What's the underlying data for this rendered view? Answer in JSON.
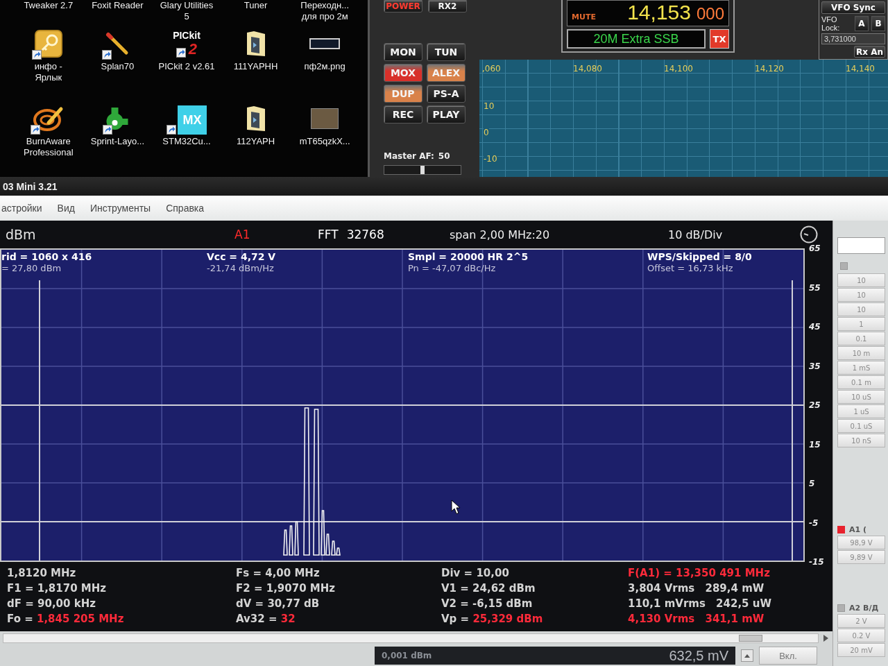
{
  "desktop": {
    "rows": [
      [
        {
          "lines": [
            "Tweaker 2.7"
          ]
        },
        {
          "lines": [
            "Foxit Reader"
          ]
        },
        {
          "lines": [
            "Glary Utilities",
            "5"
          ]
        },
        {
          "lines": [
            "Tuner"
          ]
        },
        {
          "lines": [
            "Переходн...",
            "для про 2м"
          ]
        }
      ],
      [
        {
          "lines": [
            "инфо -",
            "Ярлык"
          ],
          "kind": "key",
          "shortcut": true
        },
        {
          "lines": [
            "Splan70"
          ],
          "kind": "pencil",
          "shortcut": true
        },
        {
          "lines": [
            "PICkit 2 v2.61"
          ],
          "kind": "pickit",
          "logo": [
            "PICkit",
            "2"
          ],
          "shortcut": true
        },
        {
          "lines": [
            "111YAPHH"
          ],
          "kind": "folder",
          "shortcut": false
        },
        {
          "lines": [
            "пф2м.png"
          ],
          "kind": "image",
          "shortcut": false
        }
      ],
      [
        {
          "lines": [
            "BurnAware",
            "Professional"
          ],
          "kind": "burner",
          "shortcut": true
        },
        {
          "lines": [
            "Sprint-Layo..."
          ],
          "kind": "sprint",
          "shortcut": true
        },
        {
          "lines": [
            "STM32Cu..."
          ],
          "kind": "mx",
          "logo": [
            "MX"
          ],
          "shortcut": true
        },
        {
          "lines": [
            "112YAPH"
          ],
          "kind": "folder",
          "shortcut": false
        },
        {
          "lines": [
            "mT65qzkX..."
          ],
          "kind": "photo",
          "shortcut": false
        }
      ]
    ]
  },
  "radio": {
    "top_buttons": [
      {
        "label": "POWER",
        "on": true
      },
      {
        "label": "RX2",
        "on": false
      }
    ],
    "buttons": [
      {
        "label": "MON",
        "on": false
      },
      {
        "label": "TUN",
        "on": false
      },
      {
        "label": "MOX",
        "on": true,
        "color": "#d8302a"
      },
      {
        "label": "ALEX",
        "on": true,
        "color": "#d9824a"
      },
      {
        "label": "DUP",
        "on": true,
        "color": "#d9824a"
      },
      {
        "label": "PS-A",
        "on": false
      },
      {
        "label": "REC",
        "on": false
      },
      {
        "label": "PLAY",
        "on": false
      }
    ],
    "master_af": {
      "label": "Master AF:",
      "value": "50",
      "level": 0.5
    },
    "frequency": {
      "mute": "MUTE",
      "mhz": "14,153",
      "hz": "000"
    },
    "band": "20M Extra SSB",
    "tx_button": "TX",
    "vfo": {
      "sync_button": "VFO Sync",
      "lock_label": [
        "VFO",
        "Lock:"
      ],
      "lock_buttons": [
        "A",
        "B"
      ],
      "value": "3,731000",
      "rx_button": "Rx An"
    },
    "panadapter": {
      "x_labels": [
        ",060",
        "14,080",
        "14,100",
        "14,120",
        "14,140"
      ],
      "y_labels": [
        "10",
        "0",
        "-10"
      ]
    }
  },
  "scope": {
    "title": "03 Mini 3.21",
    "menu": [
      "астройки",
      "Вид",
      "Инструменты",
      "Справка"
    ],
    "header": {
      "unit": "dBm",
      "channel": "A1",
      "fft_label": "FFT",
      "fft_size": "32768",
      "span": "span 2,00 MHz:20",
      "scale": "10 dB/Div"
    },
    "readouts": [
      {
        "lines": [
          "rid = 1060 x 416",
          "= 27,80 dBm"
        ]
      },
      {
        "lines": [
          "Vcc = 4,72 V",
          "-21,74 dBm/Hz"
        ]
      },
      {
        "lines": [
          "Smpl = 20000 HR 2^5",
          "Pn = -47,07 dBc/Hz"
        ]
      },
      {
        "lines": [
          "WPS/Skipped = 8/0",
          "Offset = 16,73 kHz"
        ]
      }
    ],
    "y_axis_labels": [
      "65",
      "55",
      "45",
      "35",
      "25",
      "15",
      "5",
      "-5",
      "-15"
    ],
    "measurements": [
      [
        {
          "parts": [
            "1,8120 MHz"
          ],
          "value_red": false
        },
        {
          "label": "F1 =",
          "label_red": false,
          "parts": [
            "1,8170 MHz"
          ],
          "value_red": false
        },
        {
          "label": "dF =",
          "label_red": false,
          "parts": [
            "90,00 kHz"
          ],
          "value_red": false
        },
        {
          "label": "Fo =",
          "label_red": false,
          "parts": [
            "1,845 205 MHz"
          ],
          "value_red": true
        }
      ],
      [
        {
          "label": "Fs =",
          "label_red": false,
          "parts": [
            "4,00 MHz"
          ],
          "value_red": false
        },
        {
          "label": "F2 =",
          "label_red": false,
          "parts": [
            "1,9070 MHz"
          ],
          "value_red": false
        },
        {
          "label": "dV =",
          "label_red": false,
          "parts": [
            "30,77 dB"
          ],
          "value_red": false
        },
        {
          "label": "Av32 =",
          "label_red": false,
          "parts": [
            "32"
          ],
          "value_red": true
        }
      ],
      [
        {
          "label": "Div =",
          "label_red": false,
          "parts": [
            "10,00"
          ],
          "value_red": false
        },
        {
          "label": "V1 =",
          "label_red": false,
          "parts": [
            "24,62 dBm"
          ],
          "value_red": false
        },
        {
          "label": "V2 =",
          "label_red": false,
          "parts": [
            "-6,15 dBm"
          ],
          "value_red": false
        },
        {
          "label": "Vp =",
          "label_red": false,
          "parts": [
            "25,329 dBm"
          ],
          "value_red": true
        }
      ],
      [
        {
          "label": "F(A1) =",
          "label_red": true,
          "parts": [
            "13,350 491 MHz"
          ],
          "value_red": true
        },
        {
          "parts": [
            "3,804 Vrms",
            "289,4 mW"
          ],
          "value_red": false
        },
        {
          "parts": [
            "110,1 mVrms",
            "242,5 uW"
          ],
          "value_red": false
        },
        {
          "parts": [
            "4,130 Vrms",
            "341,1 mW"
          ],
          "value_red": true
        }
      ]
    ],
    "side_panel": {
      "checkbox": {
        "checked": false
      },
      "timebase": [
        "10",
        "10",
        "10",
        "1",
        "0.1",
        "10 m",
        "1 mS",
        "0.1 m",
        "10 uS",
        "1 uS",
        "0.1 uS",
        "10 nS"
      ],
      "channels": [
        {
          "label": "A1 (",
          "enabled": true,
          "ranges": [
            "98,9 V",
            "9,89 V"
          ]
        },
        {
          "label": "A2 B/Д",
          "enabled": false,
          "ranges": [
            "2 V",
            "0.2 V",
            "20 mV"
          ]
        }
      ]
    },
    "status": {
      "level_dbm": "0,001 dBm",
      "voltage": "632,5 mV",
      "on_button": "Вкл."
    }
  }
}
